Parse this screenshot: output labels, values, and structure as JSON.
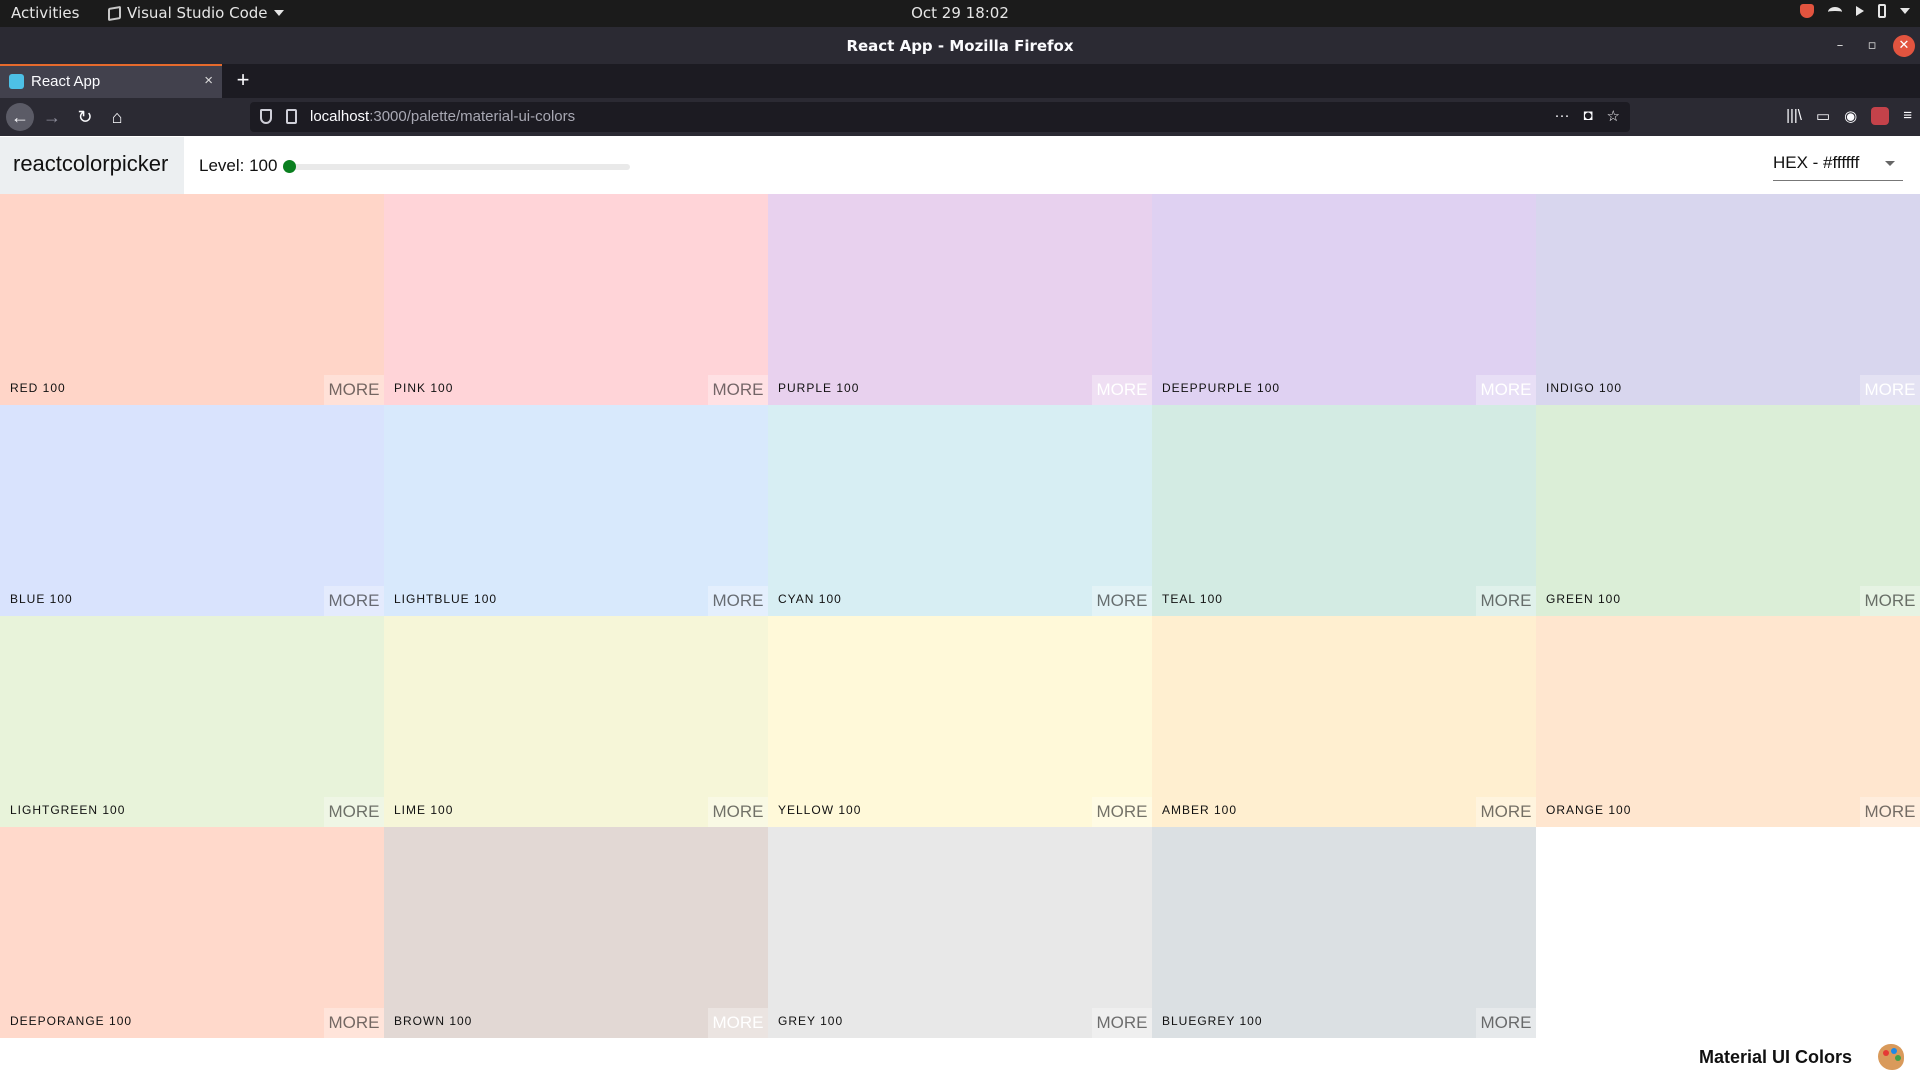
{
  "system": {
    "activities": "Activities",
    "app_name": "Visual Studio Code",
    "datetime": "Oct 29  18:02"
  },
  "window": {
    "title": "React App - Mozilla Firefox"
  },
  "tab": {
    "title": "React App",
    "close": "×",
    "new_tab": "+"
  },
  "nav": {
    "back": "←",
    "forward": "→",
    "reload": "↻",
    "home": "⌂",
    "url_host": "localhost",
    "url_path": ":3000/palette/material-ui-colors",
    "page_actions": "···",
    "pocket": "◘",
    "bookmark": "☆"
  },
  "toolbar": {
    "library": "|||\\",
    "sidebar": "▭",
    "account": "◉",
    "menu": "≡"
  },
  "app": {
    "logo": "reactcolorpicker",
    "level_label": "Level: 100",
    "level_value": 100,
    "level_min": 100,
    "level_max": 900,
    "format": "HEX - #ffffff",
    "more_label": "MORE"
  },
  "colors": [
    {
      "name": "RED 100",
      "hex": "#ffcdd2",
      "bg": "#ffd5c8",
      "more_light": false
    },
    {
      "name": "PINK 100",
      "hex": "#f8bbd0",
      "bg": "#ffd4d8",
      "more_light": false
    },
    {
      "name": "PURPLE 100",
      "hex": "#e1bee7",
      "bg": "#e8d1ee",
      "more_light": true
    },
    {
      "name": "DEEPPURPLE 100",
      "hex": "#d1c4e9",
      "bg": "#dfd1f2",
      "more_light": true
    },
    {
      "name": "INDIGO 100",
      "hex": "#c5cae9",
      "bg": "#d8d6ee",
      "more_light": true
    },
    {
      "name": "BLUE 100",
      "hex": "#bbdefb",
      "bg": "#d9e3fd",
      "more_light": false
    },
    {
      "name": "LIGHTBLUE 100",
      "hex": "#b3e5fc",
      "bg": "#d8e9fc",
      "more_light": false
    },
    {
      "name": "CYAN 100",
      "hex": "#b2ebf2",
      "bg": "#d7eef3",
      "more_light": false
    },
    {
      "name": "TEAL 100",
      "hex": "#b2dfdb",
      "bg": "#d3ebe3",
      "more_light": false
    },
    {
      "name": "GREEN 100",
      "hex": "#c8e6c9",
      "bg": "#dbeed7",
      "more_light": false
    },
    {
      "name": "LIGHTGREEN 100",
      "hex": "#dcedc8",
      "bg": "#e8f3da",
      "more_light": false
    },
    {
      "name": "LIME 100",
      "hex": "#f0f4c3",
      "bg": "#f6f6d8",
      "more_light": false
    },
    {
      "name": "YELLOW 100",
      "hex": "#fff9c4",
      "bg": "#fff9d9",
      "more_light": false
    },
    {
      "name": "AMBER 100",
      "hex": "#ffecb3",
      "bg": "#ffefd0",
      "more_light": false
    },
    {
      "name": "ORANGE 100",
      "hex": "#ffe0b2",
      "bg": "#ffe6cf",
      "more_light": false
    },
    {
      "name": "DEEPORANGE 100",
      "hex": "#ffccbc",
      "bg": "#ffd9cb",
      "more_light": false
    },
    {
      "name": "BROWN 100",
      "hex": "#d7ccc8",
      "bg": "#e2d8d4",
      "more_light": true
    },
    {
      "name": "GREY 100",
      "hex": "#f5f5f5",
      "bg": "#e8e8e8",
      "more_light": false
    },
    {
      "name": "BLUEGREY 100",
      "hex": "#cfd8dc",
      "bg": "#dbe0e3",
      "more_light": false
    }
  ],
  "footer": {
    "palette_name": "Material UI Colors",
    "emoji_name": "artist-palette-icon"
  }
}
